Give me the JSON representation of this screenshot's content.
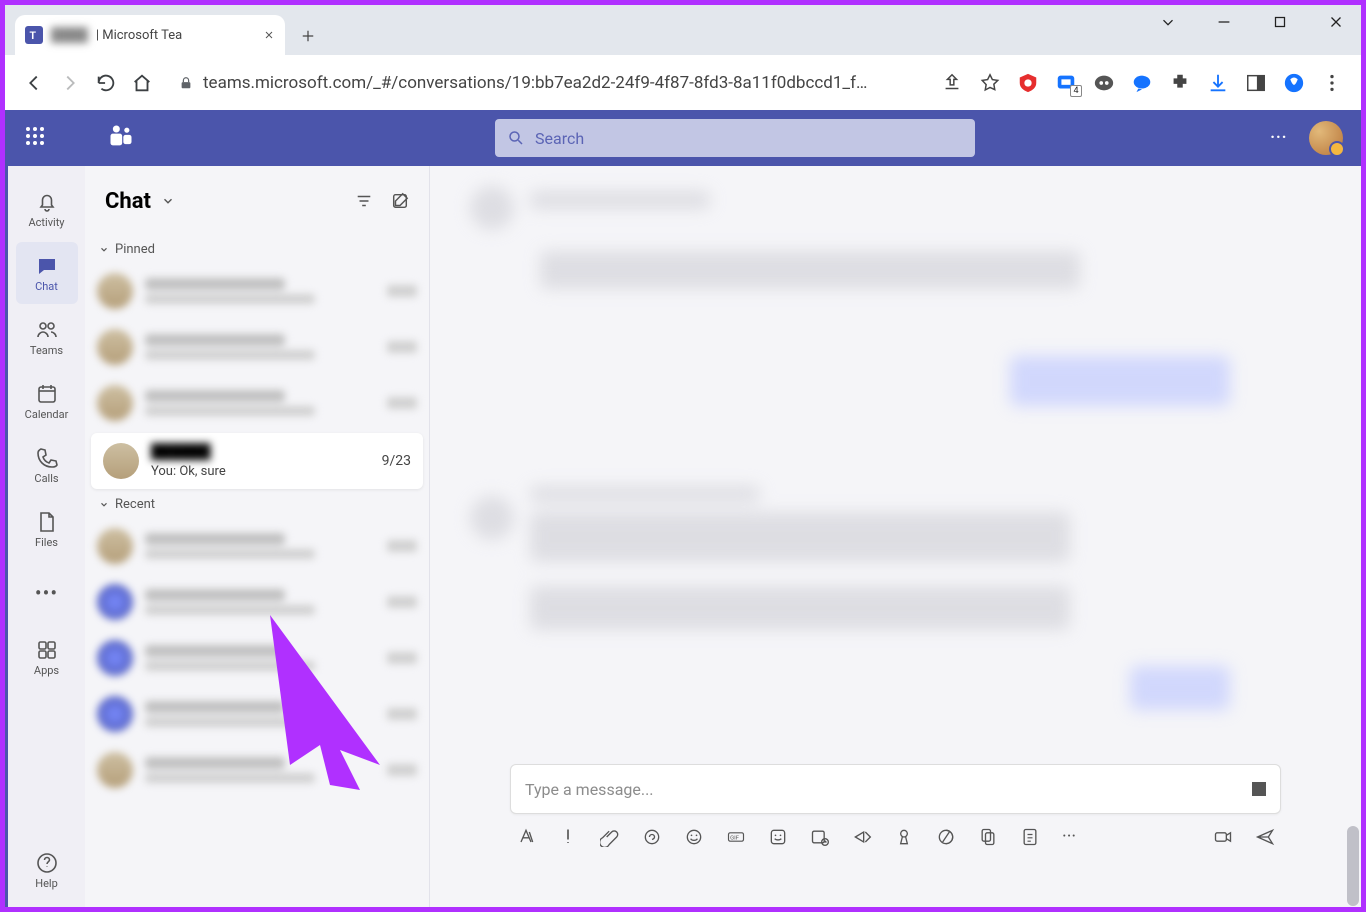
{
  "browser": {
    "tab_title": "| Microsoft Tea",
    "url": "teams.microsoft.com/_#/conversations/19:bb7ea2d2-24f9-4f87-8fd3-8a11f0dbccd1_f…",
    "ext_badge": "4"
  },
  "search": {
    "placeholder": "Search"
  },
  "rail": {
    "activity": "Activity",
    "chat": "Chat",
    "teams": "Teams",
    "calendar": "Calendar",
    "calls": "Calls",
    "files": "Files",
    "apps": "Apps",
    "help": "Help"
  },
  "chat": {
    "heading": "Chat",
    "pinned_label": "Pinned",
    "recent_label": "Recent",
    "focused": {
      "date": "9/23",
      "preview": "You: Ok, sure"
    }
  },
  "compose": {
    "placeholder": "Type a message..."
  }
}
